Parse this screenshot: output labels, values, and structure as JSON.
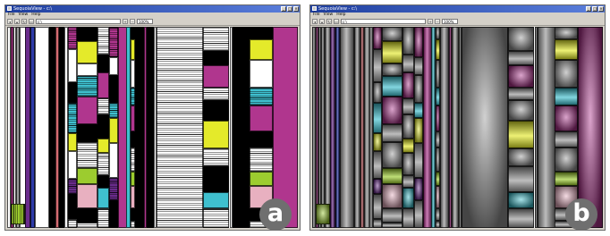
{
  "panels": [
    {
      "id": "a",
      "window_title": "SequoiaView - c:\\",
      "menu": [
        "File",
        "View",
        "Help"
      ],
      "path_value": "c:\\",
      "zoom_value": "100%",
      "render_style": "flat",
      "badge": "a"
    },
    {
      "id": "b",
      "window_title": "SequoiaView - c:\\",
      "menu": [
        "File",
        "View",
        "Help"
      ],
      "path_value": "c:\\",
      "zoom_value": "100%",
      "render_style": "cushion",
      "badge": "b"
    }
  ],
  "colors": {
    "magenta": "#b0368e",
    "purple": "#6a2c8c",
    "blue": "#2e3aa8",
    "cyan": "#3fc0cf",
    "yellow": "#e4ea2a",
    "lime": "#9ccc2f",
    "pink": "#e8b0c0",
    "salmon": "#d46b72",
    "olive": "#b9c84a",
    "gray": "#9a9a9a",
    "black": "#000000",
    "white": "#ffffff"
  }
}
